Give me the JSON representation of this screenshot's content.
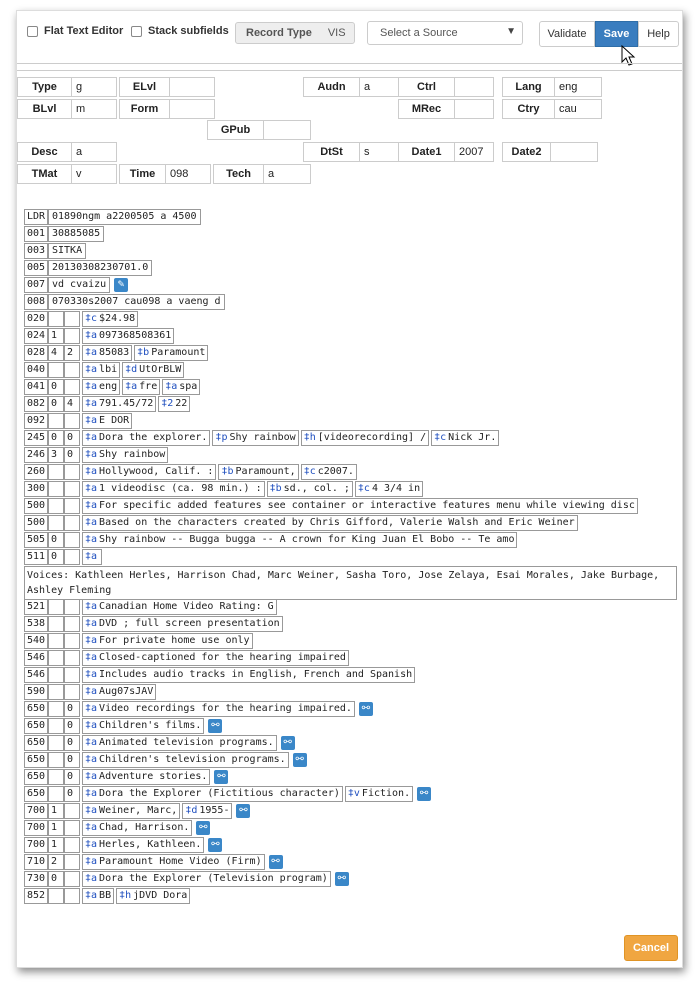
{
  "toolbar": {
    "flat_text_editor": "Flat Text Editor",
    "stack_subfields": "Stack subfields",
    "record_type_label": "Record Type",
    "record_type_value": "VIS",
    "source_placeholder": "Select a Source",
    "validate": "Validate",
    "save": "Save",
    "help": "Help"
  },
  "fixed_fields": [
    {
      "label": "Type",
      "value": "g"
    },
    {
      "label": "ELvl",
      "value": ""
    },
    {
      "label": "Audn",
      "value": "a"
    },
    {
      "label": "Ctrl",
      "value": ""
    },
    {
      "label": "Lang",
      "value": "eng"
    },
    {
      "label": "BLvl",
      "value": "m"
    },
    {
      "label": "Form",
      "value": ""
    },
    {
      "label": "MRec",
      "value": ""
    },
    {
      "label": "Ctry",
      "value": "cau"
    },
    {
      "label": "GPub",
      "value": ""
    },
    {
      "label": "Desc",
      "value": "a"
    },
    {
      "label": "DtSt",
      "value": "s"
    },
    {
      "label": "Date1",
      "value": "2007"
    },
    {
      "label": "Date2",
      "value": ""
    },
    {
      "label": "TMat",
      "value": "v"
    },
    {
      "label": "Time",
      "value": "098"
    },
    {
      "label": "Tech",
      "value": "a"
    }
  ],
  "control_fields": [
    {
      "tag": "LDR",
      "value": "01890ngm a2200505 a 4500"
    },
    {
      "tag": "001",
      "value": "30885085"
    },
    {
      "tag": "003",
      "value": "SITKA"
    },
    {
      "tag": "005",
      "value": "20130308230701.0"
    },
    {
      "tag": "007",
      "value": "vd cvaizu"
    },
    {
      "tag": "008",
      "value": "070330s2007    cau098 a          vaeng d"
    }
  ],
  "data_fields": [
    {
      "tag": "020",
      "i1": "",
      "i2": "",
      "subfields": [
        {
          "code": "‡c",
          "text": "$24.98"
        }
      ]
    },
    {
      "tag": "024",
      "i1": "1",
      "i2": "",
      "subfields": [
        {
          "code": "‡a",
          "text": "097368508361"
        }
      ]
    },
    {
      "tag": "028",
      "i1": "4",
      "i2": "2",
      "subfields": [
        {
          "code": "‡a",
          "text": "85083"
        },
        {
          "code": "‡b",
          "text": "Paramount"
        }
      ]
    },
    {
      "tag": "040",
      "i1": "",
      "i2": "",
      "subfields": [
        {
          "code": "‡a",
          "text": "lbi"
        },
        {
          "code": "‡d",
          "text": "UtOrBLW"
        }
      ]
    },
    {
      "tag": "041",
      "i1": "0",
      "i2": "",
      "subfields": [
        {
          "code": "‡a",
          "text": "eng"
        },
        {
          "code": "‡a",
          "text": "fre"
        },
        {
          "code": "‡a",
          "text": "spa"
        }
      ]
    },
    {
      "tag": "082",
      "i1": "0",
      "i2": "4",
      "subfields": [
        {
          "code": "‡a",
          "text": "791.45/72"
        },
        {
          "code": "‡2",
          "text": "22"
        }
      ]
    },
    {
      "tag": "092",
      "i1": "",
      "i2": "",
      "subfields": [
        {
          "code": "‡a",
          "text": "E DOR"
        }
      ]
    },
    {
      "tag": "245",
      "i1": "0",
      "i2": "0",
      "subfields": [
        {
          "code": "‡a",
          "text": "Dora the explorer."
        },
        {
          "code": "‡p",
          "text": "Shy rainbow"
        },
        {
          "code": "‡h",
          "text": "[videorecording] /"
        },
        {
          "code": "‡c",
          "text": "Nick Jr."
        }
      ]
    },
    {
      "tag": "246",
      "i1": "3",
      "i2": "0",
      "subfields": [
        {
          "code": "‡a",
          "text": "Shy rainbow"
        }
      ]
    },
    {
      "tag": "260",
      "i1": "",
      "i2": "",
      "subfields": [
        {
          "code": "‡a",
          "text": "Hollywood, Calif. :"
        },
        {
          "code": "‡b",
          "text": "Paramount,"
        },
        {
          "code": "‡c",
          "text": "c2007."
        }
      ]
    },
    {
      "tag": "300",
      "i1": "",
      "i2": "",
      "subfields": [
        {
          "code": "‡a",
          "text": "1 videodisc (ca. 98 min.) :"
        },
        {
          "code": "‡b",
          "text": "sd., col. ;"
        },
        {
          "code": "‡c",
          "text": "4 3/4 in"
        }
      ]
    },
    {
      "tag": "500",
      "i1": "",
      "i2": "",
      "subfields": [
        {
          "code": "‡a",
          "text": "For specific added features see container or interactive features menu while viewing disc"
        }
      ]
    },
    {
      "tag": "500",
      "i1": "",
      "i2": "",
      "subfields": [
        {
          "code": "‡a",
          "text": "Based on the characters created by Chris Gifford, Valerie Walsh and Eric Weiner"
        }
      ]
    },
    {
      "tag": "505",
      "i1": "0",
      "i2": "",
      "subfields": [
        {
          "code": "‡a",
          "text": "Shy rainbow -- Bugga bugga -- A crown for King Juan El Bobo -- Te amo"
        }
      ]
    },
    {
      "tag": "511",
      "i1": "0",
      "i2": "",
      "subfields": [
        {
          "code": "‡a",
          "text": ""
        }
      ],
      "wrap_text": "Voices: Kathleen Herles, Harrison Chad, Marc Weiner, Sasha Toro, Jose Zelaya, Esai Morales, Jake Burbage, Ashley Fleming"
    },
    {
      "tag": "521",
      "i1": "",
      "i2": "",
      "subfields": [
        {
          "code": "‡a",
          "text": "Canadian Home Video Rating: G"
        }
      ]
    },
    {
      "tag": "538",
      "i1": "",
      "i2": "",
      "subfields": [
        {
          "code": "‡a",
          "text": "DVD ; full screen presentation"
        }
      ]
    },
    {
      "tag": "540",
      "i1": "",
      "i2": "",
      "subfields": [
        {
          "code": "‡a",
          "text": "For private home use only"
        }
      ]
    },
    {
      "tag": "546",
      "i1": "",
      "i2": "",
      "subfields": [
        {
          "code": "‡a",
          "text": "Closed-captioned for the hearing impaired"
        }
      ]
    },
    {
      "tag": "546",
      "i1": "",
      "i2": "",
      "subfields": [
        {
          "code": "‡a",
          "text": "Includes audio tracks in English, French and Spanish"
        }
      ]
    },
    {
      "tag": "590",
      "i1": "",
      "i2": "",
      "subfields": [
        {
          "code": "‡a",
          "text": "Aug07sJAV"
        }
      ]
    },
    {
      "tag": "650",
      "i1": "",
      "i2": "0",
      "subfields": [
        {
          "code": "‡a",
          "text": "Video recordings for the hearing impaired."
        }
      ],
      "link": true
    },
    {
      "tag": "650",
      "i1": "",
      "i2": "0",
      "subfields": [
        {
          "code": "‡a",
          "text": "Children's films."
        }
      ],
      "link": true
    },
    {
      "tag": "650",
      "i1": "",
      "i2": "0",
      "subfields": [
        {
          "code": "‡a",
          "text": "Animated television programs."
        }
      ],
      "link": true
    },
    {
      "tag": "650",
      "i1": "",
      "i2": "0",
      "subfields": [
        {
          "code": "‡a",
          "text": "Children's television programs."
        }
      ],
      "link": true
    },
    {
      "tag": "650",
      "i1": "",
      "i2": "0",
      "subfields": [
        {
          "code": "‡a",
          "text": "Adventure stories."
        }
      ],
      "link": true
    },
    {
      "tag": "650",
      "i1": "",
      "i2": "0",
      "subfields": [
        {
          "code": "‡a",
          "text": "Dora the Explorer (Fictitious character)"
        },
        {
          "code": "‡v",
          "text": "Fiction."
        }
      ],
      "link": true
    },
    {
      "tag": "700",
      "i1": "1",
      "i2": "",
      "subfields": [
        {
          "code": "‡a",
          "text": "Weiner, Marc,"
        },
        {
          "code": "‡d",
          "text": "1955-"
        }
      ],
      "link": true
    },
    {
      "tag": "700",
      "i1": "1",
      "i2": "",
      "subfields": [
        {
          "code": "‡a",
          "text": "Chad, Harrison."
        }
      ],
      "link": true
    },
    {
      "tag": "700",
      "i1": "1",
      "i2": "",
      "subfields": [
        {
          "code": "‡a",
          "text": "Herles, Kathleen."
        }
      ],
      "link": true
    },
    {
      "tag": "710",
      "i1": "2",
      "i2": "",
      "subfields": [
        {
          "code": "‡a",
          "text": "Paramount Home Video (Firm)"
        }
      ],
      "link": true
    },
    {
      "tag": "730",
      "i1": "0",
      "i2": "",
      "subfields": [
        {
          "code": "‡a",
          "text": "Dora the Explorer (Television program)"
        }
      ],
      "link": true
    },
    {
      "tag": "852",
      "i1": "",
      "i2": "",
      "subfields": [
        {
          "code": "‡a",
          "text": "BB"
        },
        {
          "code": "‡h",
          "text": "jDVD Dora"
        }
      ]
    }
  ],
  "footer": {
    "cancel": "Cancel"
  },
  "colors": {
    "save": "#3a7dbf",
    "cancel": "#f0a641",
    "subfield_code": "#1f4fbf",
    "link_icon": "#3a87c8"
  }
}
